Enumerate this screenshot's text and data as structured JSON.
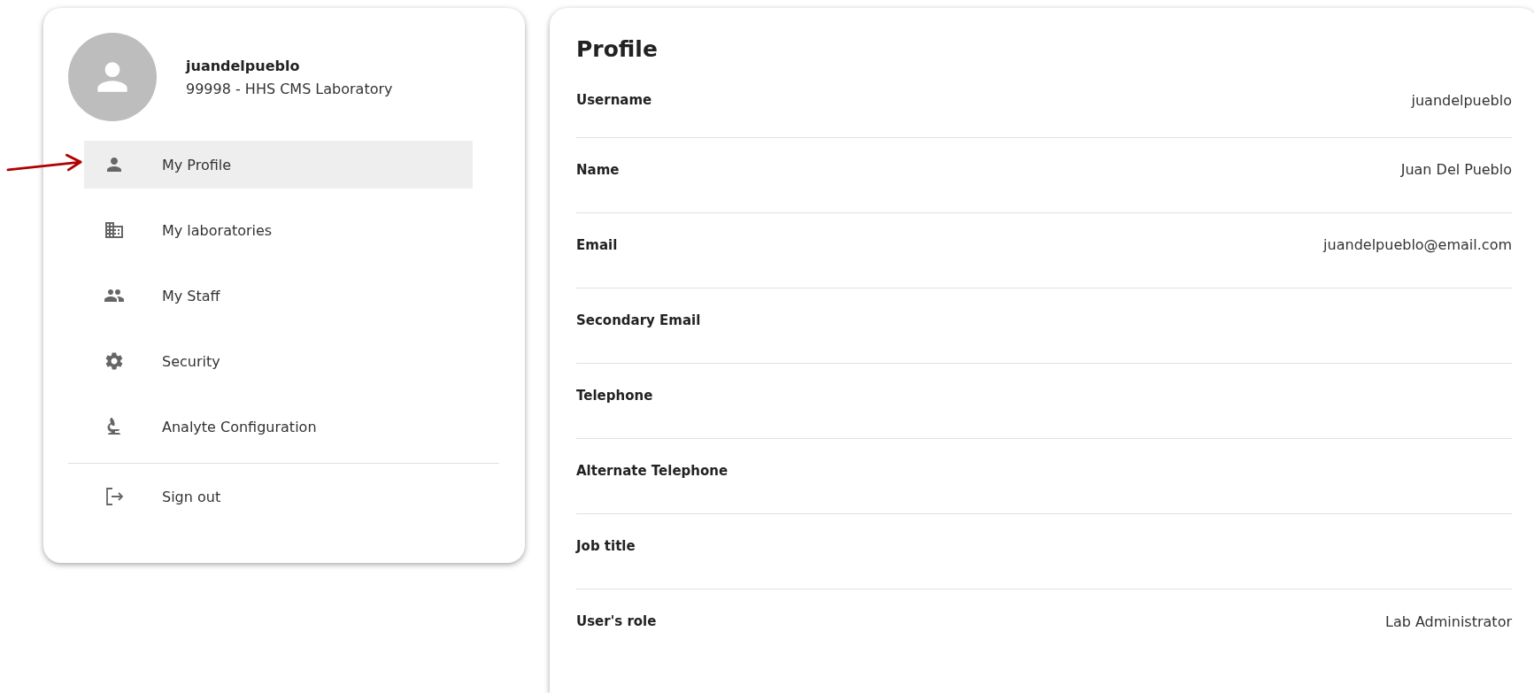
{
  "user": {
    "username": "juandelpueblo",
    "laboratory": "99998 - HHS CMS Laboratory"
  },
  "menu": [
    {
      "label": "My Profile",
      "selected": true,
      "pointed": true
    },
    {
      "label": "My laboratories",
      "selected": false,
      "pointed": false
    },
    {
      "label": "My Staff",
      "selected": false,
      "pointed": false
    },
    {
      "label": "Security",
      "selected": false,
      "pointed": false
    },
    {
      "label": "Analyte Configuration",
      "selected": false,
      "pointed": false
    }
  ],
  "sign_out": {
    "label": "Sign out"
  },
  "profile": {
    "title": "Profile",
    "fields": [
      {
        "label": "Username",
        "value": "juandelpueblo"
      },
      {
        "label": "Name",
        "value": "Juan Del Pueblo"
      },
      {
        "label": "Email",
        "value": "juandelpueblo@email.com"
      },
      {
        "label": "Secondary Email"
      },
      {
        "label": "Telephone"
      },
      {
        "label": "Alternate Telephone"
      },
      {
        "label": "Job title"
      },
      {
        "label": "User's role",
        "value": "Lab Administrator"
      }
    ]
  }
}
